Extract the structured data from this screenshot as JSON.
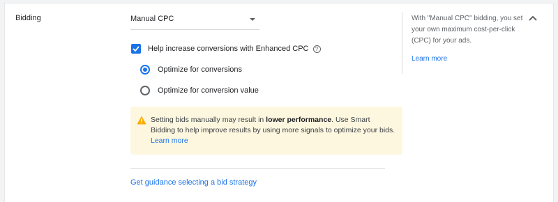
{
  "section": {
    "label": "Bidding"
  },
  "bid_strategy": {
    "selected": "Manual CPC"
  },
  "enhanced_cpc": {
    "checked": true,
    "label": "Help increase conversions with Enhanced CPC",
    "help_icon": "?"
  },
  "optimize_options": [
    {
      "label": "Optimize for conversions",
      "selected": true
    },
    {
      "label": "Optimize for conversion value",
      "selected": false
    }
  ],
  "warning": {
    "icon": "warning-triangle-icon",
    "text_before": "Setting bids manually may result in ",
    "text_bold": "lower performance",
    "text_after": ". Use Smart Bidding to help improve results by using more signals to optimize your bids.",
    "link": "Learn more"
  },
  "guidance_link": "Get guidance selecting a bid strategy",
  "info_panel": {
    "text": "With \"Manual CPC\" bidding, you set your own maximum cost-per-click (CPC) for your ads.",
    "link": "Learn more"
  },
  "colors": {
    "accent": "#1a73e8",
    "warning_bg": "#fef7e0",
    "warning_icon": "#f9ab00"
  }
}
